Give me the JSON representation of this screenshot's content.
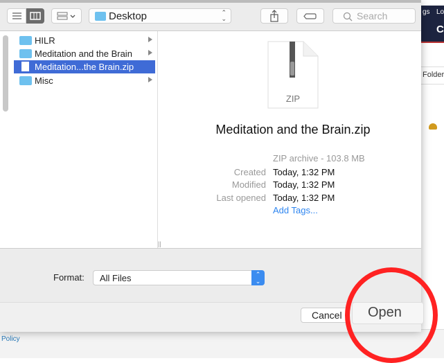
{
  "background_page": {
    "nav_text_1": "gs",
    "nav_text_2": "Lo",
    "nav_heading": "C",
    "folder_button": "Folder",
    "footer_link": "Policy",
    "cloud_icon": "cloud-icon",
    "cloud_color": "#d19a1e"
  },
  "toolbar": {
    "location": "Desktop",
    "search_placeholder": "Search",
    "view_mode": "columns"
  },
  "files": [
    {
      "name": "HILR",
      "type": "folder"
    },
    {
      "name": "Meditation and the Brain",
      "type": "folder"
    },
    {
      "name": "Meditation...the Brain.zip",
      "type": "file",
      "selected": true
    },
    {
      "name": "Misc",
      "type": "folder"
    }
  ],
  "preview": {
    "icon_label": "ZIP",
    "filename": "Meditation and the Brain.zip",
    "kind": "ZIP archive - 103.8 MB",
    "meta": [
      {
        "key": "Created",
        "value": "Today, 1:32 PM"
      },
      {
        "key": "Modified",
        "value": "Today, 1:32 PM"
      },
      {
        "key": "Last opened",
        "value": "Today, 1:32 PM"
      }
    ],
    "add_tags": "Add Tags..."
  },
  "format": {
    "label": "Format:",
    "value": "All Files"
  },
  "buttons": {
    "cancel": "Cancel",
    "open": "Open"
  },
  "annotation": {
    "shape": "circle",
    "color": "#ff2200",
    "target": "Open"
  }
}
